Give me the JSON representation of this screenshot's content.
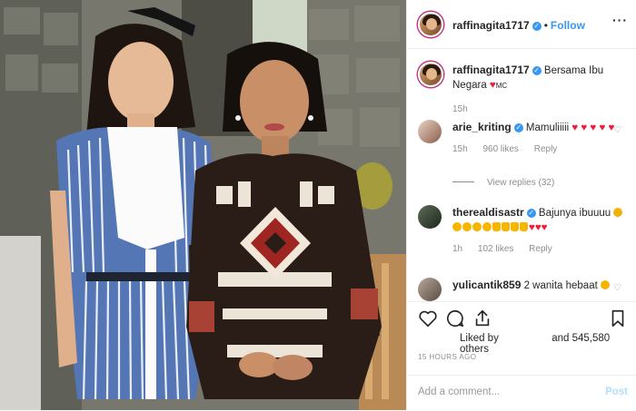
{
  "header": {
    "username": "raffinagita1717",
    "separator": "•",
    "follow_label": "Follow",
    "more_label": "···"
  },
  "caption": {
    "username": "raffinagita1717",
    "text": "Bersama Ibu Negara",
    "suffix": "MC",
    "age": "15h"
  },
  "comments": [
    {
      "username": "arie_kriting",
      "verified": true,
      "text": "Mamuliiiii",
      "age": "15h",
      "likes": "960 likes",
      "reply_label": "Reply",
      "view_replies": "View replies (32)"
    },
    {
      "username": "therealdisastr",
      "verified": true,
      "text": "Bajunya ibuuuu",
      "age": "1h",
      "likes": "102 likes",
      "reply_label": "Reply"
    },
    {
      "username": "yulicantik859",
      "verified": false,
      "text": "2 wanita hebaat"
    }
  ],
  "actions": {
    "liked_by_label": "Liked by",
    "likes_count": "and 545,580 others",
    "timestamp": "15 HOURS AGO"
  },
  "composer": {
    "placeholder": "Add a comment...",
    "post_label": "Post"
  },
  "colors": {
    "accent": "#3897f0",
    "heart": "#ed1c3a",
    "muted": "#8e8e8e"
  }
}
